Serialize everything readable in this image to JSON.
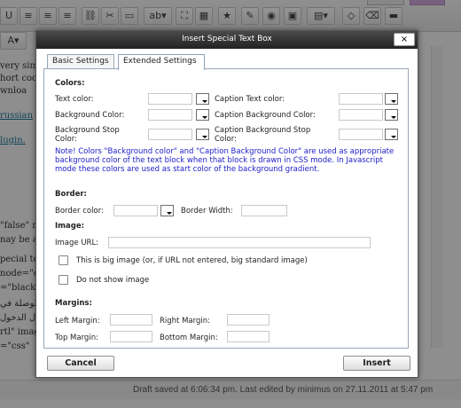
{
  "background": {
    "toolbar_icons": [
      "align-left-icon",
      "align-center-icon",
      "align-right-icon",
      "link-icon",
      "unlink-icon",
      "more-tag-icon",
      "spellcheck-icon",
      "fullscreen-icon",
      "special-text-icon",
      "star-icon",
      "insert-image-icon",
      "media-icon",
      "table-icon",
      "format-icon",
      "html-icon",
      "paste-icon"
    ],
    "editor_lines": [
      "very sim",
      "hort coo",
      "wnloa",
      "russian",
      "lugin.",
      "\"false\" m",
      "nay be a",
      "pecial te",
      "node=\"c",
      "=\"black\"",
      "لوصلة في",
      "ل الدخول",
      "rtl\" imag",
      "=\"css\""
    ],
    "status_text": "Draft saved at 6:06:34 pm. Last edited by minimus on 27.11.2011 at 5:47 pm"
  },
  "dialog": {
    "title": "Insert Special Text Box",
    "close_glyph": "×",
    "tabs": [
      {
        "label": "Basic Settings",
        "active": false
      },
      {
        "label": "Extended Settings",
        "active": true
      }
    ],
    "colors": {
      "heading": "Colors:",
      "text_color_label": "Text color:",
      "caption_text_color_label": "Caption Text color:",
      "background_color_label": "Background Color:",
      "caption_background_color_label": "Caption Background Color:",
      "background_stop_color_label": "Background Stop Color:",
      "caption_background_stop_color_label": "Caption Background Stop Color:",
      "note": "Note! Colors \"Background color\" and \"Caption Background Color\" are used as appropriate background color of the text block when that block is drawn in CSS mode. In Javascript mode these colors are used as start color of the background gradient."
    },
    "border": {
      "heading": "Border:",
      "border_color_label": "Border color:",
      "border_width_label": "Border Width:"
    },
    "image": {
      "heading": "Image:",
      "image_url_label": "Image URL:",
      "big_image_label": "This is big image (or, if URL not entered, big standard image)",
      "big_image_checked": false,
      "no_image_label": "Do not show image",
      "no_image_checked": false
    },
    "margins": {
      "heading": "Margins:",
      "left_label": "Left Margin:",
      "right_label": "Right Margin:",
      "top_label": "Top Margin:",
      "bottom_label": "Bottom Margin:"
    },
    "buttons": {
      "cancel": "Cancel",
      "insert": "Insert"
    }
  },
  "colors": {
    "note_text": "#2020c8",
    "titlebar": "#333333",
    "link": "#21759b"
  }
}
